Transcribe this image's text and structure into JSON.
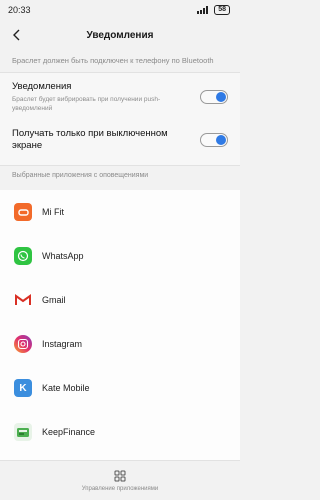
{
  "status_bar": {
    "time": "20:33",
    "battery": "58"
  },
  "header": {
    "title": "Уведомления"
  },
  "note": "Браслет должен быть подключен к телефону по Bluetooth",
  "settings": [
    {
      "title": "Уведомления",
      "subtitle": "Браслет будет вибрировать при получении push-уведомлений",
      "enabled": true
    },
    {
      "title": "Получать только при выключенном экране",
      "enabled": true
    }
  ],
  "apps_section_label": "Выбранные приложения с оповещениями",
  "apps": [
    {
      "name": "Mi Fit",
      "icon": "mifit-icon",
      "color": "#f26a2a"
    },
    {
      "name": "WhatsApp",
      "icon": "whatsapp-icon",
      "color": "#2fc442"
    },
    {
      "name": "Gmail",
      "icon": "gmail-icon",
      "color": "#d93025"
    },
    {
      "name": "Instagram",
      "icon": "instagram-icon",
      "color": "#c13584"
    },
    {
      "name": "Kate Mobile",
      "icon": "kate-mobile-icon",
      "color": "#3b8ede"
    },
    {
      "name": "KeepFinance",
      "icon": "keepfinance-icon",
      "color": "#4caf50"
    }
  ],
  "bottom": {
    "label": "Управление приложениями"
  },
  "colors": {
    "accent": "#2f7ae5"
  }
}
